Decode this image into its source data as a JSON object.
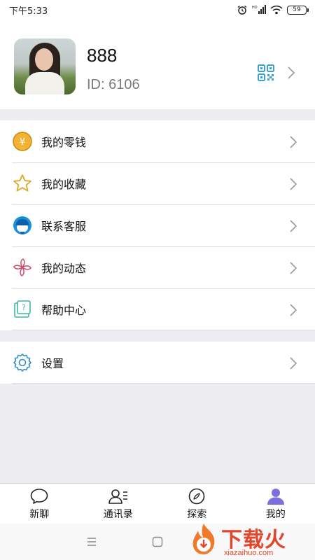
{
  "status_bar": {
    "time": "下午5:33",
    "hd": "HD",
    "battery": "59"
  },
  "profile": {
    "name": "888",
    "id": "ID: 6106"
  },
  "menu": [
    {
      "label": "我的零钱",
      "icon": "wallet-coin-icon"
    },
    {
      "label": "我的收藏",
      "icon": "star-icon"
    },
    {
      "label": "联系客服",
      "icon": "customer-service-icon"
    },
    {
      "label": "我的动态",
      "icon": "pinwheel-icon"
    },
    {
      "label": "帮助中心",
      "icon": "help-center-icon"
    }
  ],
  "settings": {
    "label": "设置",
    "icon": "gear-icon"
  },
  "tabs": [
    {
      "label": "新聊",
      "icon": "chat-bubble-icon"
    },
    {
      "label": "通讯录",
      "icon": "contacts-icon"
    },
    {
      "label": "探索",
      "icon": "compass-icon"
    },
    {
      "label": "我的",
      "icon": "person-icon",
      "active": true
    }
  ],
  "watermark": {
    "title": "下载火",
    "site": "xiazaihuo.com"
  },
  "colors": {
    "accent": "#3aa0d8",
    "active_tab": "#7b6fe0",
    "coin": "#f2b233",
    "pinwheel": "#d04a6a",
    "watermark": "#e4452a"
  }
}
